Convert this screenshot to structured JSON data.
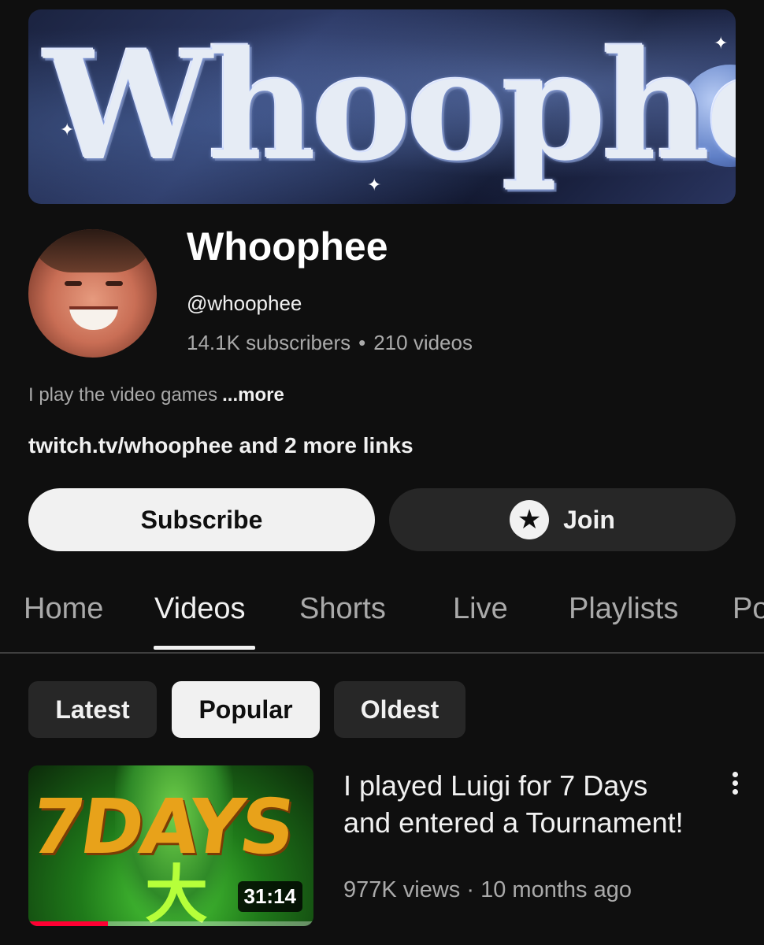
{
  "channel": {
    "banner_text": "Whoophee",
    "name": "Whoophee",
    "handle": "@whoophee",
    "subscribers": "14.1K subscribers",
    "separator": "•",
    "videos": "210 videos",
    "description": "I play the video games",
    "description_more": "...more",
    "links": "twitch.tv/whoophee and 2 more links"
  },
  "actions": {
    "subscribe_label": "Subscribe",
    "join_label": "Join",
    "join_icon": "star-icon"
  },
  "tabs": [
    {
      "label": "Home",
      "active": false
    },
    {
      "label": "Videos",
      "active": true
    },
    {
      "label": "Shorts",
      "active": false
    },
    {
      "label": "Live",
      "active": false
    },
    {
      "label": "Playlists",
      "active": false
    },
    {
      "label": "Po",
      "active": false
    }
  ],
  "filters": [
    {
      "label": "Latest",
      "active": false
    },
    {
      "label": "Popular",
      "active": true
    },
    {
      "label": "Oldest",
      "active": false
    }
  ],
  "video": {
    "thumbnail_text": "7DAYS",
    "duration": "31:14",
    "watch_progress": 0.28,
    "title": "I played Luigi for 7 Days and entered a Tournament!",
    "views": "977K views",
    "meta_separator": "·",
    "age": "10 months ago"
  },
  "colors": {
    "background": "#0f0f0f",
    "progress": "#ff0033",
    "chip_active": "#f1f1f1",
    "chip_inactive": "#272727"
  }
}
